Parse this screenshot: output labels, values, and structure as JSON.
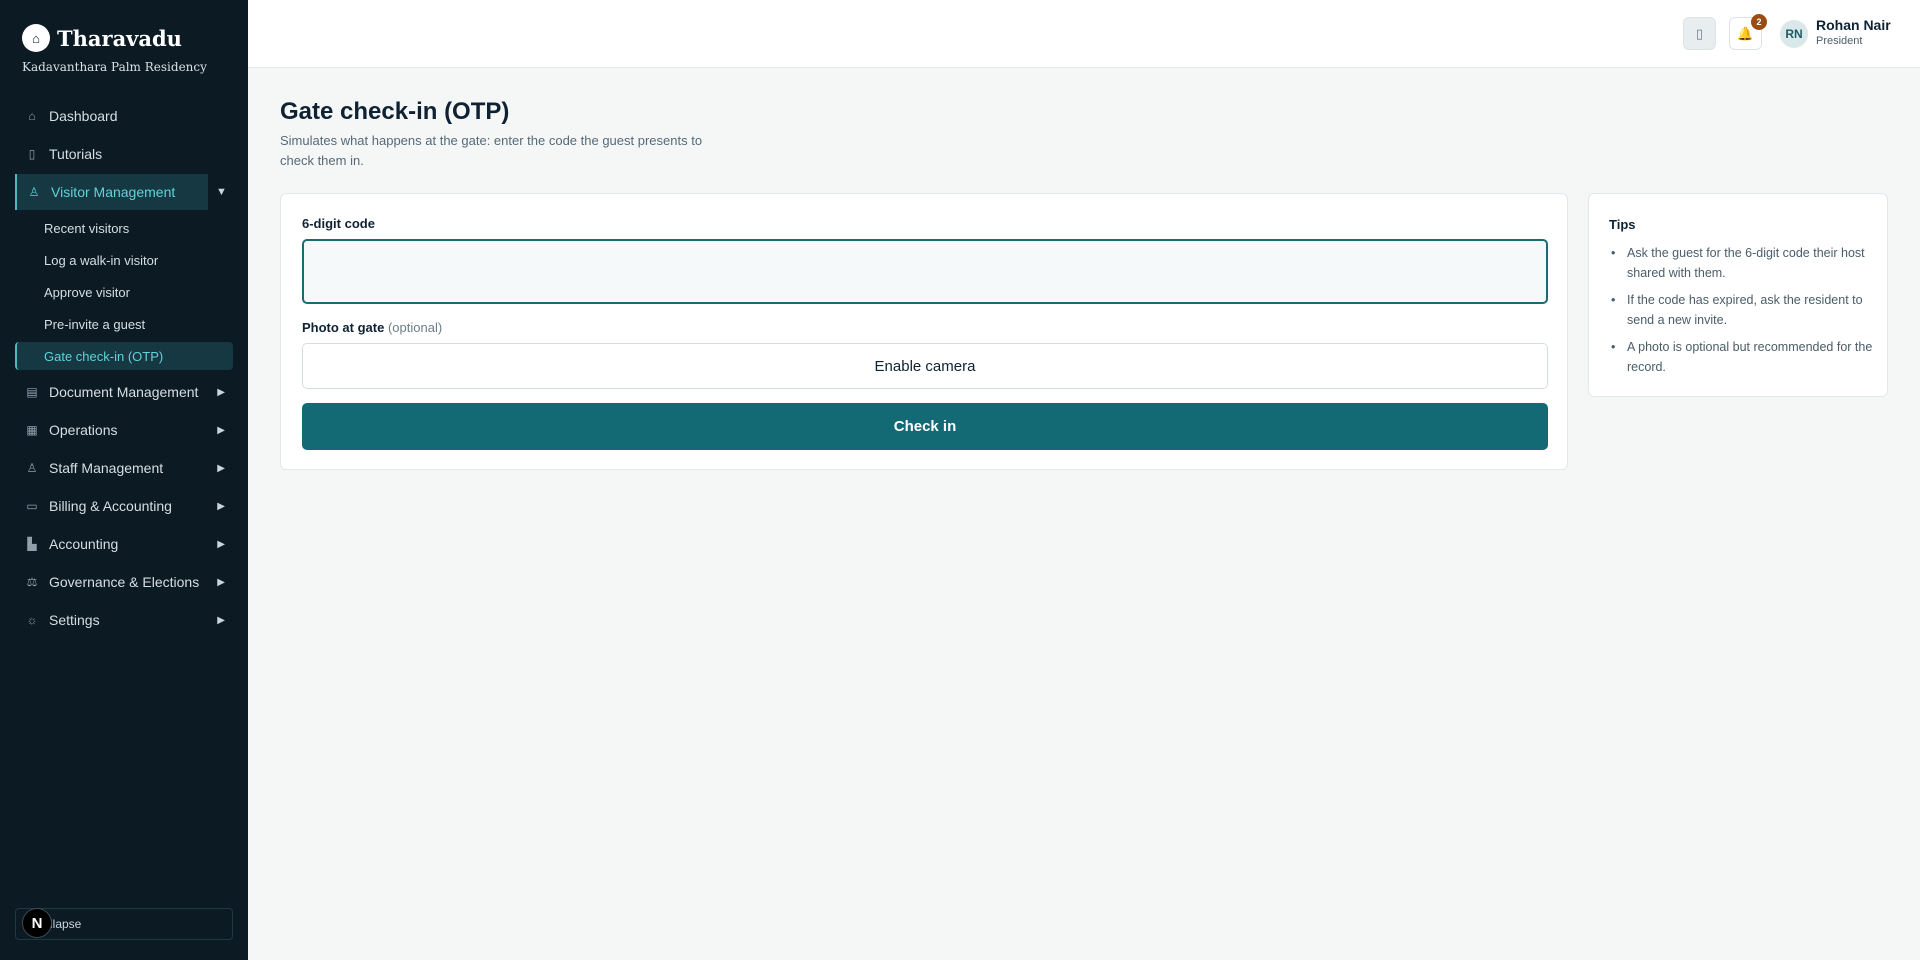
{
  "brand": {
    "name": "Tharavadu",
    "subtitle": "Kadavanthara Palm Residency",
    "logo_icon": "house-logo-icon"
  },
  "sidebar": {
    "items": [
      {
        "label": "Dashboard",
        "icon": "home-icon"
      },
      {
        "label": "Tutorials",
        "icon": "book-icon"
      },
      {
        "label": "Visitor Management",
        "icon": "user-check-icon",
        "expanded": true,
        "children": [
          "Recent visitors",
          "Log a walk-in visitor",
          "Approve visitor",
          "Pre-invite a guest",
          "Gate check-in (OTP)"
        ],
        "active_child": "Gate check-in (OTP)"
      },
      {
        "label": "Document Management",
        "icon": "document-icon"
      },
      {
        "label": "Operations",
        "icon": "grid-icon"
      },
      {
        "label": "Staff Management",
        "icon": "users-icon"
      },
      {
        "label": "Billing & Accounting",
        "icon": "credit-card-icon"
      },
      {
        "label": "Accounting",
        "icon": "bar-chart-icon"
      },
      {
        "label": "Governance & Elections",
        "icon": "gavel-icon"
      },
      {
        "label": "Settings",
        "icon": "gear-icon"
      }
    ],
    "collapse_label": "llapse",
    "n_badge": "N"
  },
  "topbar": {
    "notifications_count": "2",
    "user": {
      "initials": "RN",
      "name": "Rohan Nair",
      "role": "President"
    }
  },
  "main": {
    "title": "Gate check-in (OTP)",
    "description": "Simulates what happens at the gate: enter the code the guest presents to check them in.",
    "code_label": "6-digit code",
    "code_value": "",
    "photo_label": "Photo at gate",
    "photo_optional": "(optional)",
    "camera_button": "Enable camera",
    "checkin_button": "Check in"
  },
  "tips": {
    "title": "Tips",
    "items": [
      "Ask the guest for the 6-digit code their host shared with them.",
      "If the code has expired, ask the resident to send a new invite.",
      "A photo is optional but recommended for the record."
    ]
  },
  "colors": {
    "sidebar_bg": "#0c1a24",
    "accent": "#136a74",
    "active_text": "#5fd3d8"
  }
}
